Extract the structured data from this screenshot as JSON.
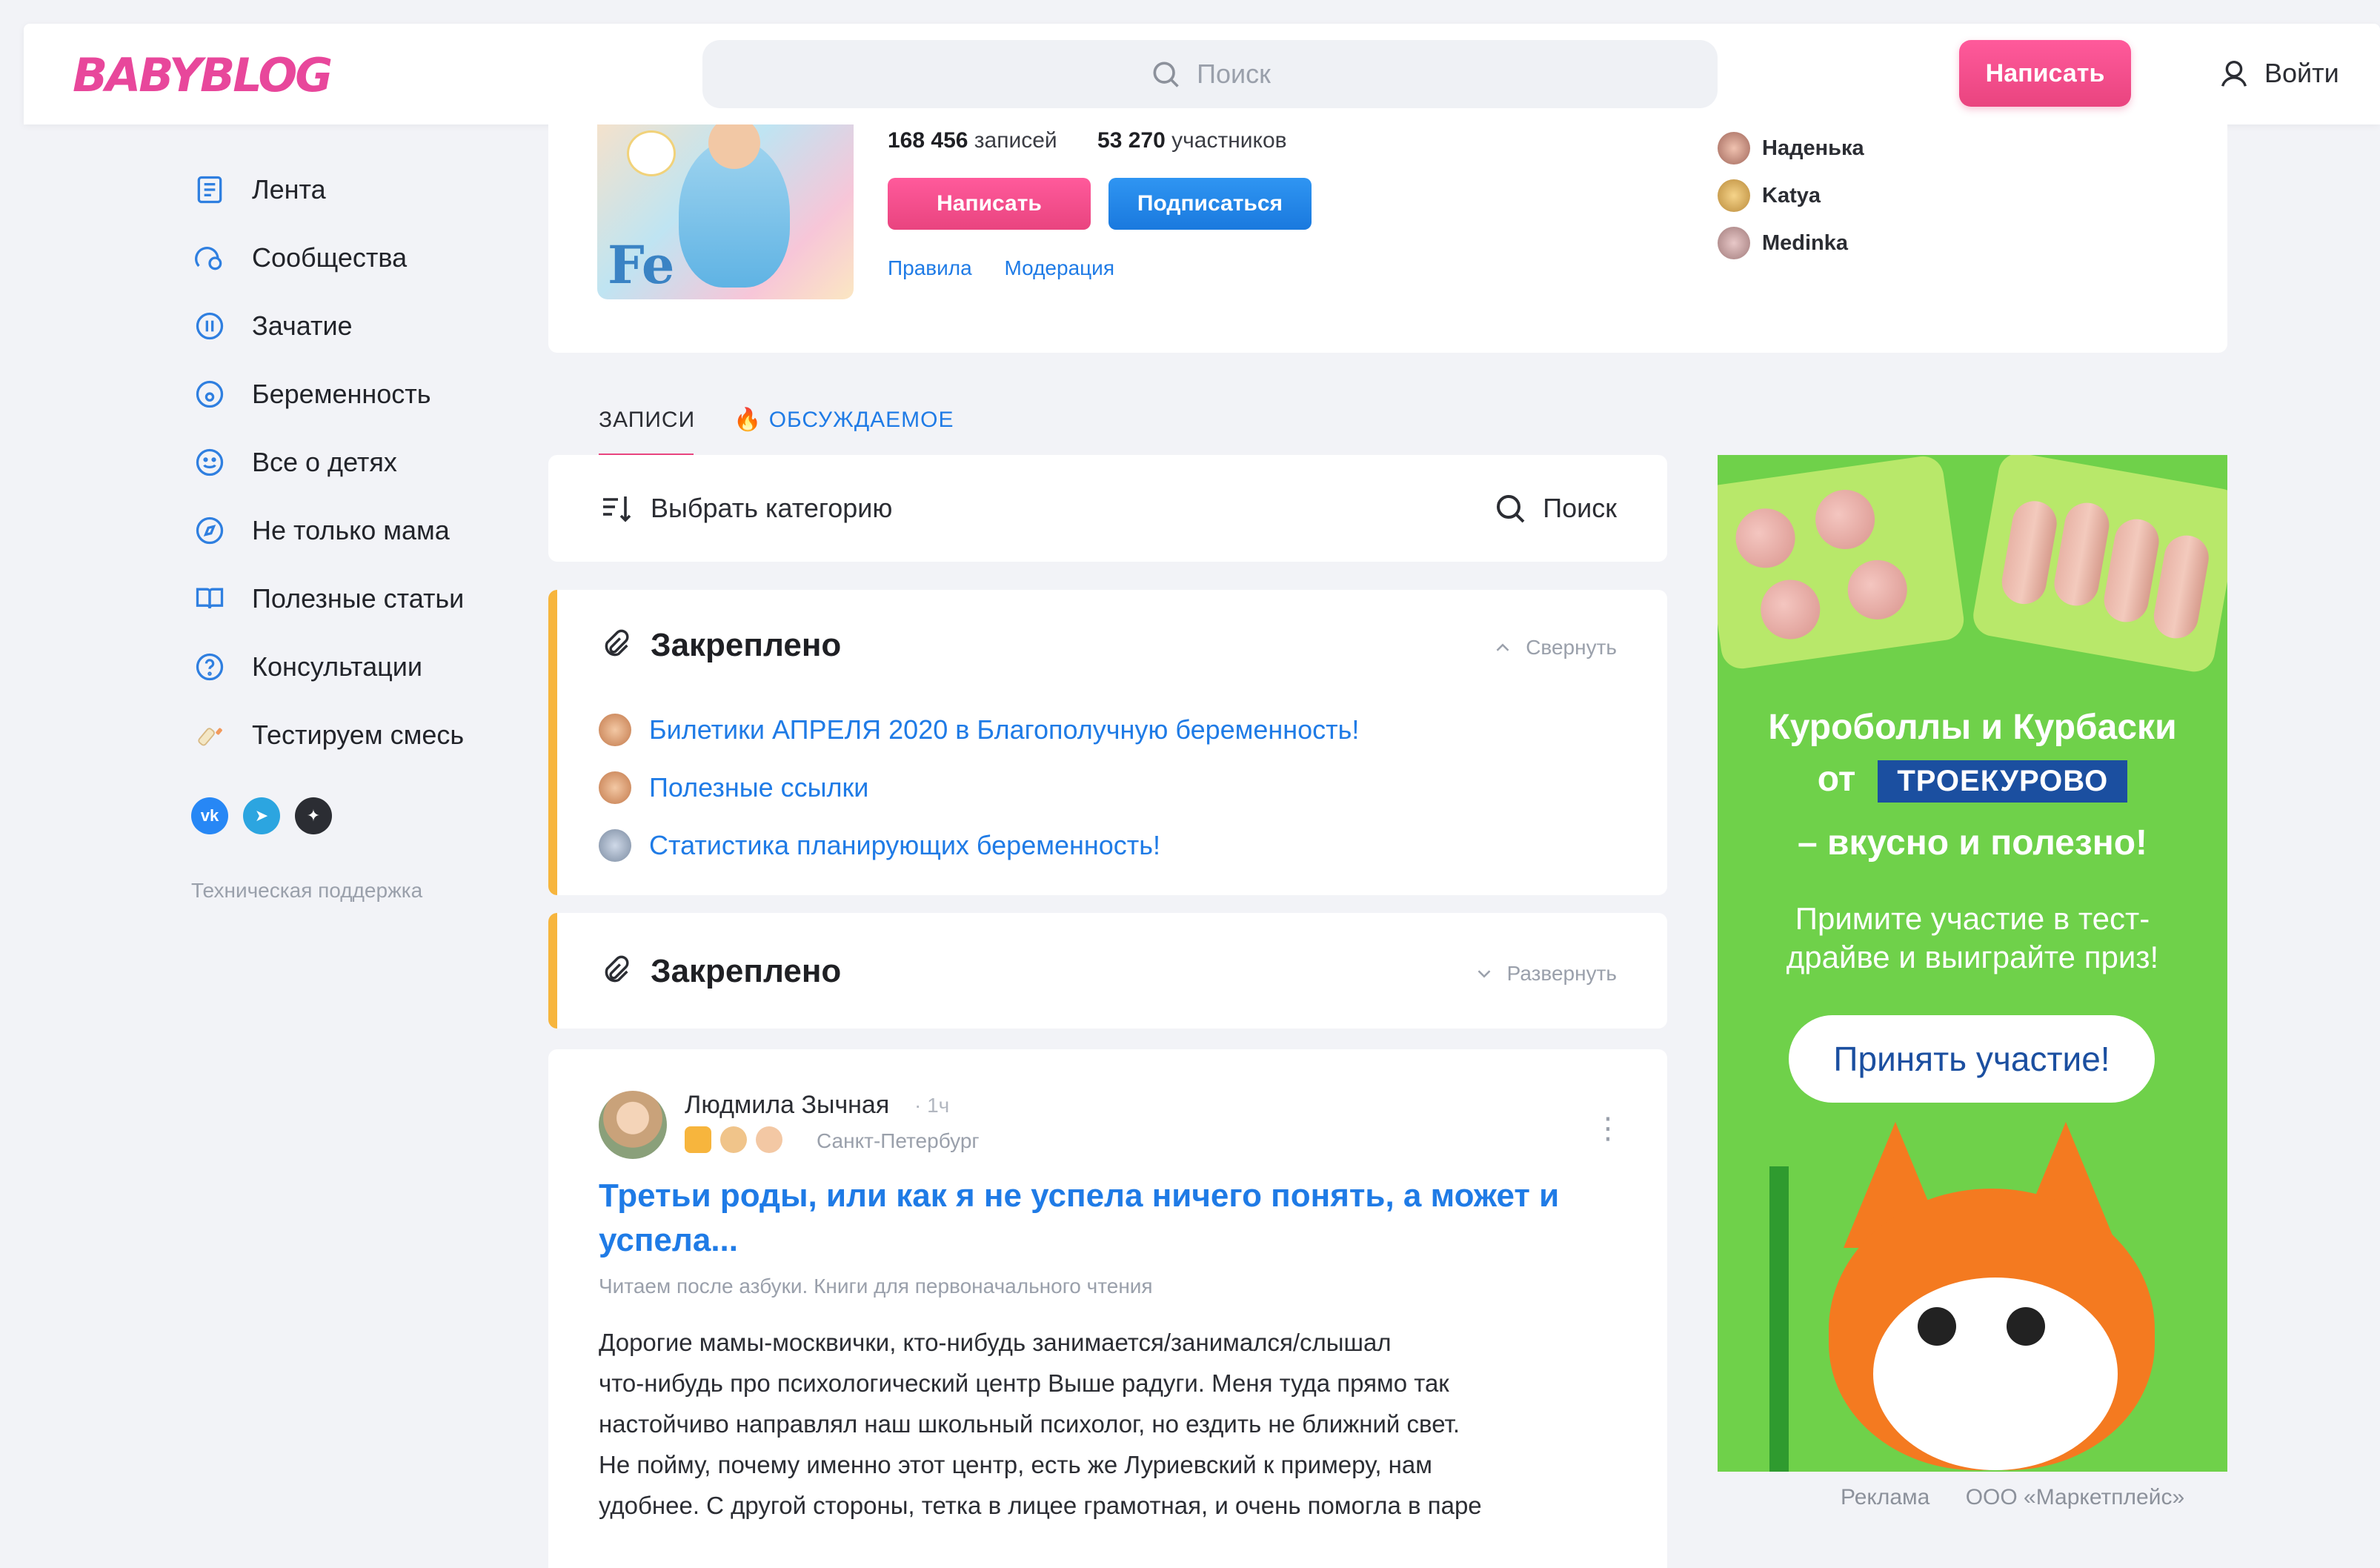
{
  "header": {
    "logo": "BABYBLOG",
    "search_placeholder": "Поиск",
    "write_button": "Написать",
    "login": "Войти"
  },
  "sidebar": {
    "items": [
      {
        "label": "Лента",
        "icon": "feed-icon"
      },
      {
        "label": "Сообщества",
        "icon": "community-icon"
      },
      {
        "label": "Зачатие",
        "icon": "conception-icon"
      },
      {
        "label": "Беременность",
        "icon": "pregnancy-icon"
      },
      {
        "label": "Все о детях",
        "icon": "smile-icon"
      },
      {
        "label": "Не только мама",
        "icon": "compass-icon"
      },
      {
        "label": "Полезные статьи",
        "icon": "book-icon"
      },
      {
        "label": "Консультации",
        "icon": "question-icon"
      },
      {
        "label": "Тестируем смесь",
        "icon": "bottle-icon"
      }
    ],
    "socials": [
      "vk-icon",
      "telegram-icon",
      "star-icon"
    ],
    "support": "Техническая поддержка"
  },
  "community": {
    "posts_count": "168 456",
    "posts_label": "записей",
    "members_count": "53 270",
    "members_label": "участников",
    "write_button": "Написать",
    "subscribe_button": "Подписаться",
    "links": [
      "Правила",
      "Модерация"
    ],
    "members": [
      "Наденька",
      "Katya",
      "Medinka"
    ]
  },
  "tabs": {
    "posts": "ЗАПИСИ",
    "discussed": "ОБСУЖДАЕМОЕ"
  },
  "filter": {
    "category": "Выбрать категорию",
    "search": "Поиск"
  },
  "pinned": [
    {
      "title": "Закреплено",
      "toggle": "Свернуть",
      "links": [
        "Билетики АПРЕЛЯ 2020 в Благополучную беременность!",
        "Полезные ссылки",
        "Статистика планирующих беременность!"
      ]
    },
    {
      "title": "Закреплено",
      "toggle": "Развернуть"
    }
  ],
  "post": {
    "author": "Людмила Зычная",
    "time": "1ч",
    "city": "Санкт-Петербург",
    "title": "Третьи роды, или как я не успела ничего понять, а может и успела...",
    "rubric": "Читаем после азбуки. Книги для первоначального чтения",
    "body": [
      "Дорогие мамы-москвички, кто-нибудь занимается/занимался/слышал",
      "что-нибудь про психологический центр Выше радуги. Меня туда прямо так",
      "настойчиво направлял наш школьный психолог, но ездить не ближний свет.",
      "Не пойму, почему именно этот центр, есть же Луриевский к примеру, нам",
      "удобнее. С другой стороны, тетка в лицее грамотная, и очень помогла в паре"
    ]
  },
  "ad": {
    "headline1": "Куроболлы и Курбаски",
    "headline2_prefix": "от",
    "brand": "ТРОЕКУРОВО",
    "headline3": "– вкусно и полезно!",
    "subtext1": "Примите участие в тест-",
    "subtext2": "драйве и выиграйте приз!",
    "button": "Принять участие!",
    "footer_label": "Реклама",
    "footer_company": "ООО «Маркетплейс»"
  },
  "colors": {
    "accent_pink": "#e9447f",
    "link_blue": "#1f7be6",
    "pinned_bar": "#f7b53d",
    "ad_green": "#6fd14a"
  }
}
